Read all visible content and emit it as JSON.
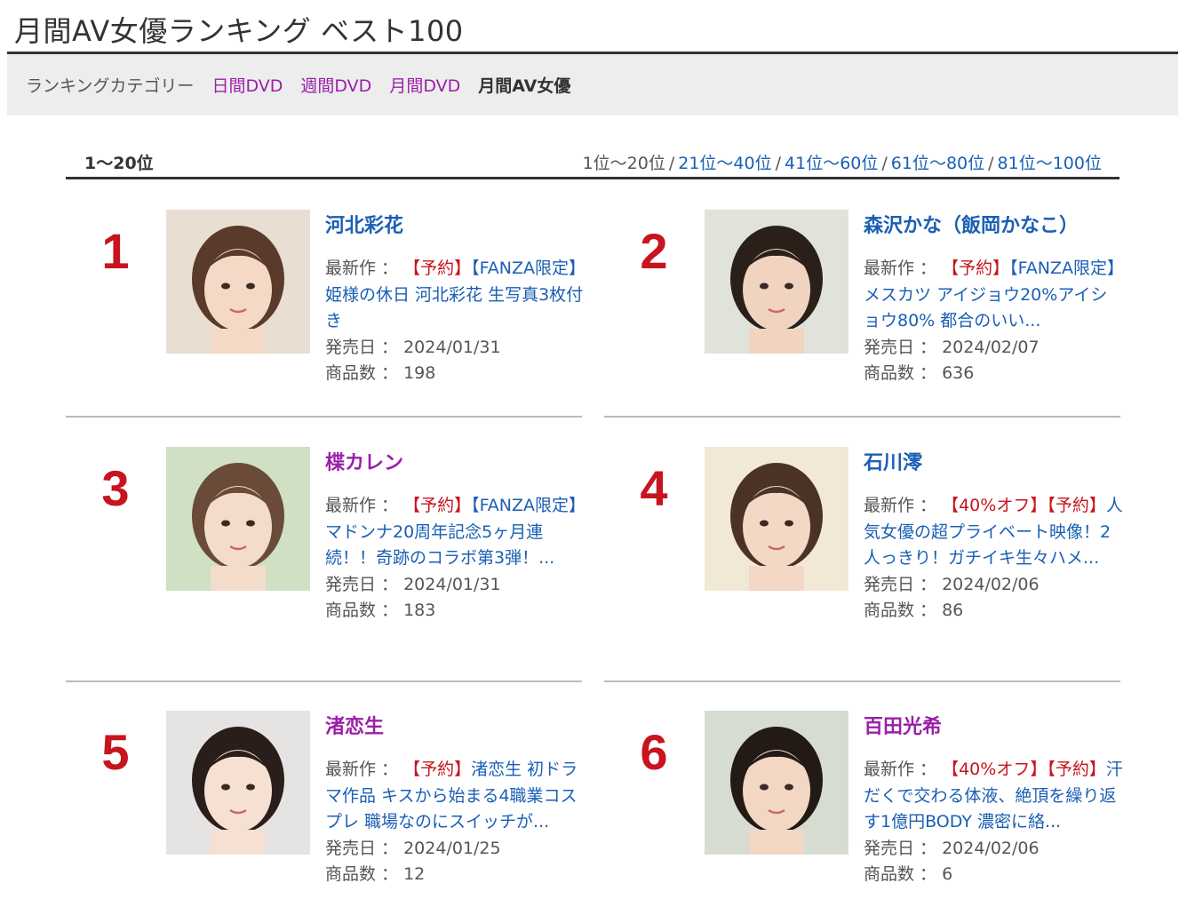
{
  "page": {
    "title": "月間AV女優ランキング ベスト100"
  },
  "category_bar": {
    "label": "ランキングカテゴリー",
    "links": [
      "日間DVD",
      "週間DVD",
      "月間DVD"
    ],
    "current": "月間AV女優"
  },
  "range": {
    "current": "1〜20位",
    "nav_current": "1位〜20位",
    "nav_links": [
      "21位〜40位",
      "41位〜60位",
      "61位〜80位",
      "81位〜100位"
    ],
    "separator": "/"
  },
  "labels": {
    "latest": "最新作",
    "release": "発売日",
    "count": "商品数",
    "colon": "："
  },
  "colors": {
    "rank_red": "#c8141e",
    "link_blue": "#1a5fb4",
    "link_purple": "#9b1fa8"
  },
  "actresses": [
    {
      "rank": "1",
      "name": "河北彩花",
      "tags": [
        "【予約】"
      ],
      "title": "【FANZA限定】姫様の休日 河北彩花 生写真3枚付き",
      "release_date": "2024/01/31",
      "item_count": "198"
    },
    {
      "rank": "2",
      "name": "森沢かな（飯岡かなこ）",
      "tags": [
        "【予約】"
      ],
      "title": "【FANZA限定】メスカツ アイジョウ20%アイショウ80% 都合のいい...",
      "release_date": "2024/02/07",
      "item_count": "636"
    },
    {
      "rank": "3",
      "name": "楪カレン",
      "tags": [
        "【予約】"
      ],
      "title": "【FANZA限定】マドンナ20周年記念5ヶ月連続！！奇跡のコラボ第3弾！...",
      "release_date": "2024/01/31",
      "item_count": "183"
    },
    {
      "rank": "4",
      "name": "石川澪",
      "tags": [
        "【40%オフ】",
        "【予約】"
      ],
      "title": "人気女優の超プライベート映像！2人っきり！ガチイキ生々ハメ...",
      "release_date": "2024/02/06",
      "item_count": "86"
    },
    {
      "rank": "5",
      "name": "渚恋生",
      "tags": [
        "【予約】"
      ],
      "title": "渚恋生 初ドラマ作品 キスから始まる4職業コスプレ 職場なのにスイッチが...",
      "release_date": "2024/01/25",
      "item_count": "12"
    },
    {
      "rank": "6",
      "name": "百田光希",
      "tags": [
        "【40%オフ】",
        "【予約】"
      ],
      "title": "汗だくで交わる体液、絶頂を繰り返す1億円BODY 濃密に絡...",
      "release_date": "2024/02/06",
      "item_count": "6"
    }
  ]
}
